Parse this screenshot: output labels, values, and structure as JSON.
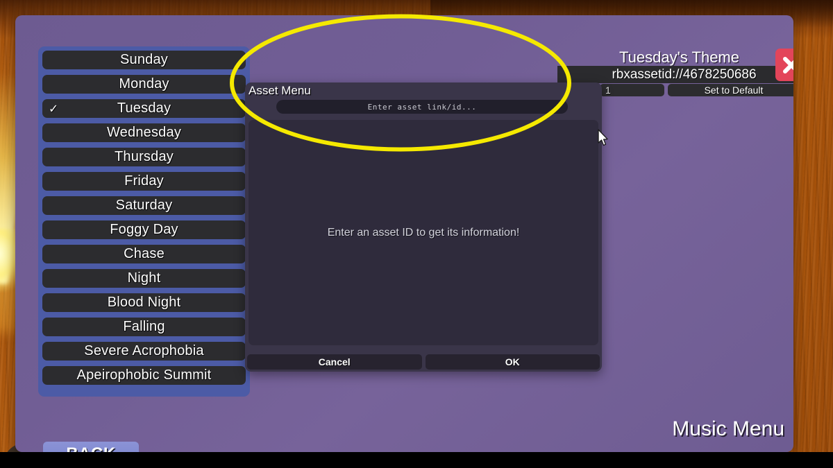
{
  "window": {
    "theme_name": "Tuesday's Theme",
    "asset_id": "rbxassetid://4678250686",
    "volume_value": "1",
    "set_default_label": "Set to Default",
    "close_icon": "close-x-icon",
    "back_label": "BACK",
    "menu_title": "Music Menu"
  },
  "day_list": {
    "items": [
      {
        "label": "Sunday",
        "selected": false
      },
      {
        "label": "Monday",
        "selected": false
      },
      {
        "label": "Tuesday",
        "selected": true
      },
      {
        "label": "Wednesday",
        "selected": false
      },
      {
        "label": "Thursday",
        "selected": false
      },
      {
        "label": "Friday",
        "selected": false
      },
      {
        "label": "Saturday",
        "selected": false
      },
      {
        "label": "Foggy Day",
        "selected": false
      },
      {
        "label": "Chase",
        "selected": false
      },
      {
        "label": "Night",
        "selected": false
      },
      {
        "label": "Blood Night",
        "selected": false
      },
      {
        "label": "Falling",
        "selected": false
      },
      {
        "label": "Severe Acrophobia",
        "selected": false
      },
      {
        "label": "Apeirophobic Summit",
        "selected": false
      }
    ],
    "check_glyph": "✓"
  },
  "dialog": {
    "title": "Asset Menu",
    "input_placeholder": "Enter asset link/id...",
    "input_value": "",
    "body_message": "Enter an asset ID to get its information!",
    "cancel_label": "Cancel",
    "ok_label": "OK"
  },
  "annotation": {
    "shape": "ellipse-highlight",
    "color": "#f5e900"
  },
  "colors": {
    "panel_purple": "#715e95",
    "list_blue": "#4c5ba6",
    "item_dark": "#2c2c2f",
    "dialog_dark": "#3a3549",
    "close_red": "#e3455a",
    "back_blue": "#828bd1",
    "wood_orange": "#c2650f"
  }
}
